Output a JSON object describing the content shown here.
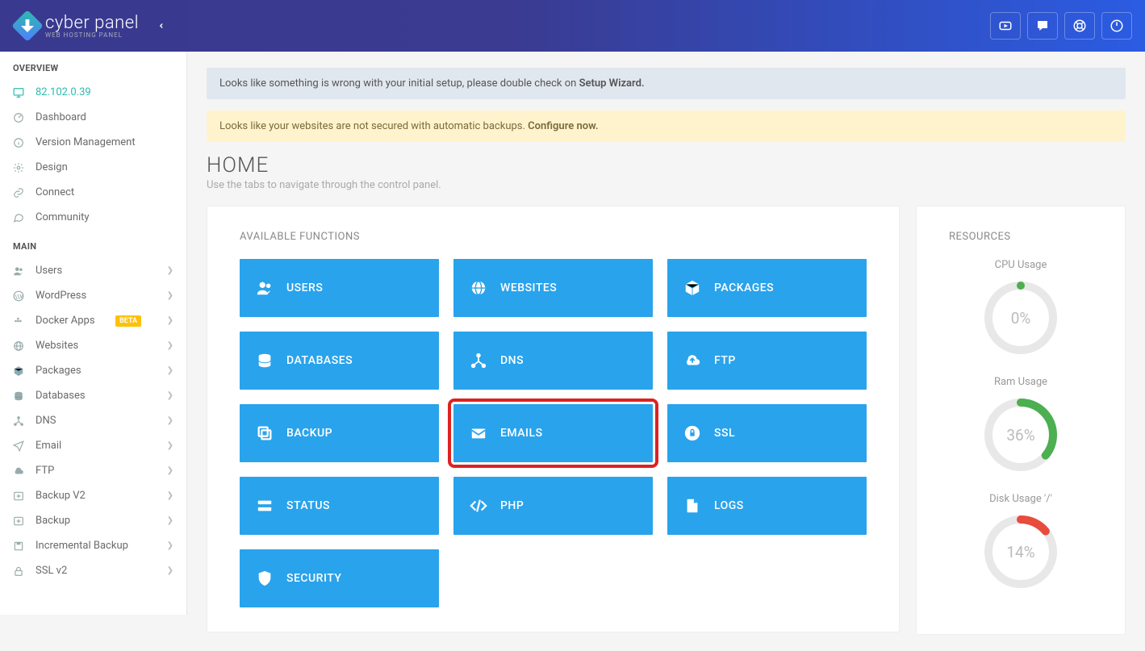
{
  "brand": {
    "name": "cyber panel",
    "subtitle": "WEB HOSTING PANEL"
  },
  "topbar_icons": [
    "youtube-icon",
    "chat-icon",
    "help-icon",
    "power-icon"
  ],
  "sidebar": {
    "sections": [
      {
        "title": "OVERVIEW",
        "items": [
          {
            "icon": "monitor-icon",
            "label": "82.102.0.39",
            "ip": true
          },
          {
            "icon": "dashboard-icon",
            "label": "Dashboard"
          },
          {
            "icon": "info-icon",
            "label": "Version Management"
          },
          {
            "icon": "gear-icon",
            "label": "Design"
          },
          {
            "icon": "link-icon",
            "label": "Connect"
          },
          {
            "icon": "comments-icon",
            "label": "Community"
          }
        ]
      },
      {
        "title": "MAIN",
        "items": [
          {
            "icon": "users-icon",
            "label": "Users",
            "expandable": true
          },
          {
            "icon": "wordpress-icon",
            "label": "WordPress",
            "expandable": true
          },
          {
            "icon": "docker-icon",
            "label": "Docker Apps",
            "badge": "BETA",
            "expandable": true
          },
          {
            "icon": "globe-icon",
            "label": "Websites",
            "expandable": true
          },
          {
            "icon": "packages-icon",
            "label": "Packages",
            "expandable": true
          },
          {
            "icon": "database-icon",
            "label": "Databases",
            "expandable": true
          },
          {
            "icon": "dns-icon",
            "label": "DNS",
            "expandable": true
          },
          {
            "icon": "send-icon",
            "label": "Email",
            "expandable": true
          },
          {
            "icon": "cloud-icon",
            "label": "FTP",
            "expandable": true
          },
          {
            "icon": "backup-icon",
            "label": "Backup V2",
            "expandable": true
          },
          {
            "icon": "backup-icon",
            "label": "Backup",
            "expandable": true
          },
          {
            "icon": "save-icon",
            "label": "Incremental Backup",
            "expandable": true
          },
          {
            "icon": "lock-icon",
            "label": "SSL v2",
            "expandable": true
          }
        ]
      }
    ]
  },
  "alerts": {
    "info_prefix": "Looks like something is wrong with your initial setup, please double check on ",
    "info_link": "Setup Wizard.",
    "warn_prefix": "Looks like your websites are not secured with automatic backups. ",
    "warn_link": "Configure now."
  },
  "page": {
    "title": "HOME",
    "subtitle": "Use the tabs to navigate through the control panel."
  },
  "functions": {
    "heading": "AVAILABLE FUNCTIONS",
    "tiles": [
      {
        "icon": "users-icon",
        "label": "USERS"
      },
      {
        "icon": "globe-icon",
        "label": "WEBSITES"
      },
      {
        "icon": "packages-icon",
        "label": "PACKAGES"
      },
      {
        "icon": "database-icon",
        "label": "DATABASES"
      },
      {
        "icon": "dns-icon",
        "label": "DNS"
      },
      {
        "icon": "cloud-icon",
        "label": "FTP"
      },
      {
        "icon": "copy-icon",
        "label": "BACKUP"
      },
      {
        "icon": "mail-icon",
        "label": "EMAILS",
        "highlighted": true
      },
      {
        "icon": "ssl-icon",
        "label": "SSL"
      },
      {
        "icon": "status-icon",
        "label": "STATUS"
      },
      {
        "icon": "code-icon",
        "label": "PHP"
      },
      {
        "icon": "file-icon",
        "label": "LOGS"
      },
      {
        "icon": "shield-icon",
        "label": "SECURITY"
      }
    ]
  },
  "resources": {
    "heading": "RESOURCES",
    "items": [
      {
        "label": "CPU Usage",
        "value": 0,
        "display": "0%",
        "color": "#4caf50"
      },
      {
        "label": "Ram Usage",
        "value": 36,
        "display": "36%",
        "color": "#4caf50"
      },
      {
        "label": "Disk Usage '/'",
        "value": 14,
        "display": "14%",
        "color": "#e74c3c"
      }
    ]
  }
}
